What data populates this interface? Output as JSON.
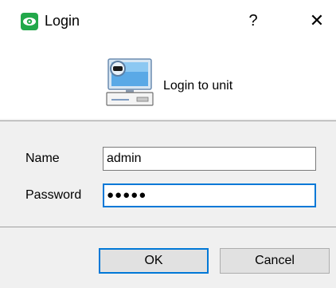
{
  "window": {
    "title": "Login",
    "help_glyph": "?",
    "close_glyph": "✕",
    "app_icon": "eye-icon"
  },
  "header": {
    "icon": "computer-icon",
    "text": "Login to unit"
  },
  "form": {
    "name_label": "Name",
    "name_value": "admin",
    "password_label": "Password",
    "password_value": "●●●●●"
  },
  "buttons": {
    "ok_label": "OK",
    "cancel_label": "Cancel"
  },
  "colors": {
    "accent": "#0078d7",
    "app_icon_green": "#22a84a"
  }
}
